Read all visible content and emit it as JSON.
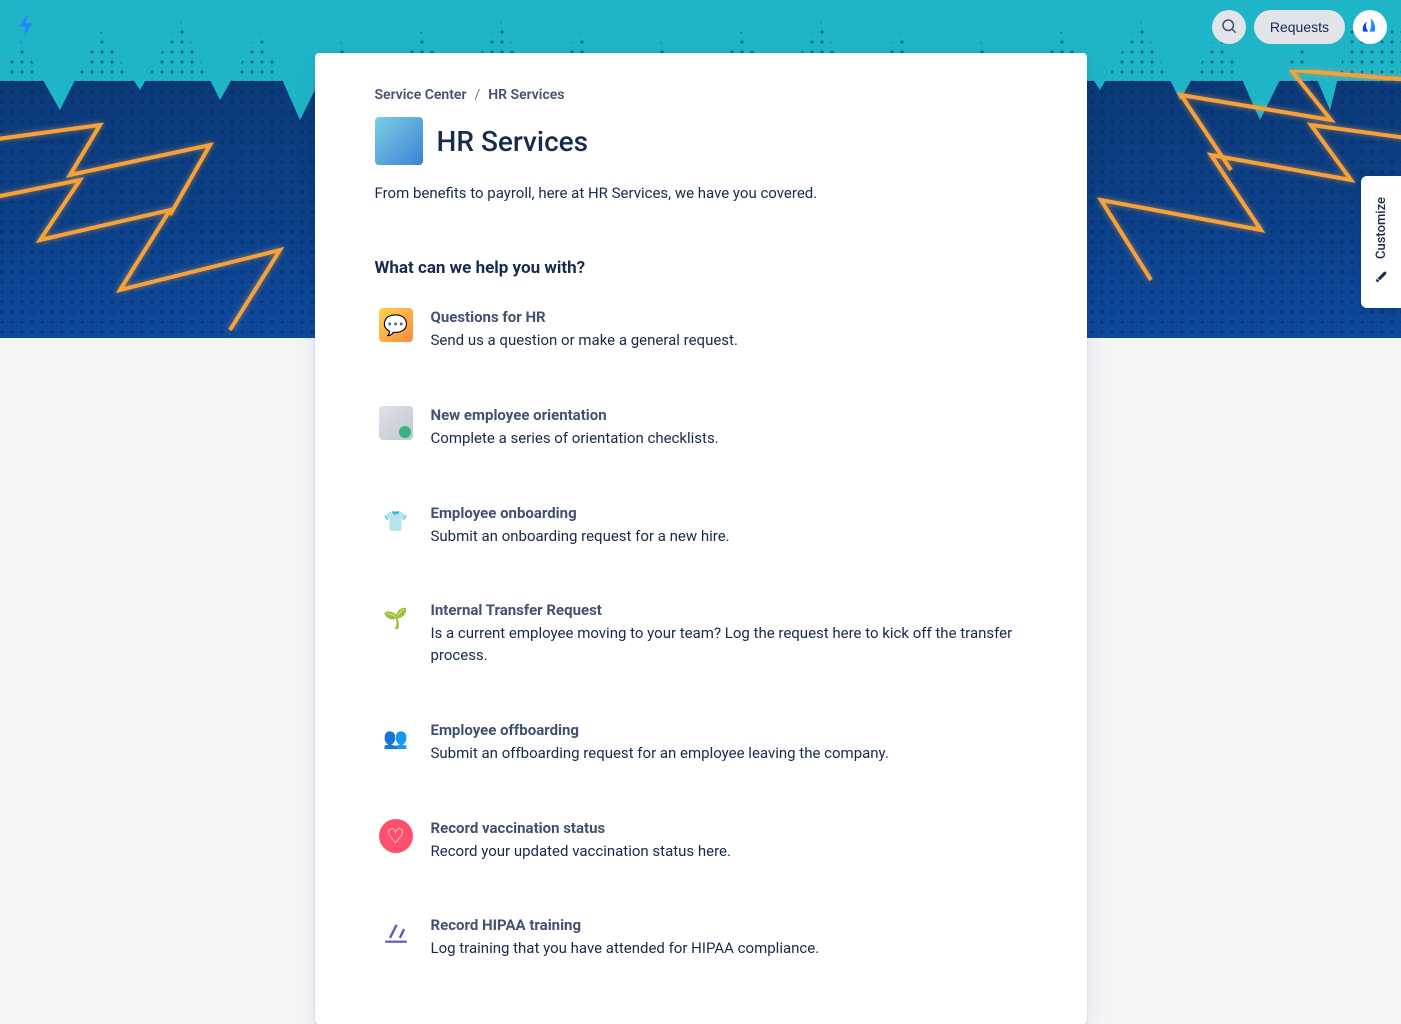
{
  "header": {
    "requests_label": "Requests",
    "customize_label": "Customize"
  },
  "breadcrumb": {
    "root": "Service Center",
    "current": "HR Services"
  },
  "page": {
    "title": "HR Services",
    "description": "From benefits to payroll, here at HR Services, we have you covered.",
    "section_heading": "What can we help you with?"
  },
  "requests": [
    {
      "title": "Questions for HR",
      "description": "Send us a question or make a general request.",
      "icon": "questions-icon"
    },
    {
      "title": "New employee orientation",
      "description": "Complete a series of orientation checklists.",
      "icon": "orientation-icon"
    },
    {
      "title": "Employee onboarding",
      "description": "Submit an onboarding request for a new hire.",
      "icon": "onboarding-icon"
    },
    {
      "title": "Internal Transfer Request",
      "description": "Is a current employee moving to your team? Log the request here to kick off the transfer process.",
      "icon": "transfer-icon"
    },
    {
      "title": "Employee offboarding",
      "description": "Submit an offboarding request for an employee leaving the company.",
      "icon": "offboarding-icon"
    },
    {
      "title": "Record vaccination status",
      "description": "Record your updated vaccination status here.",
      "icon": "vaccination-icon"
    },
    {
      "title": "Record HIPAA training",
      "description": "Log training that you have attended for HIPAA compliance.",
      "icon": "hipaa-icon"
    }
  ]
}
